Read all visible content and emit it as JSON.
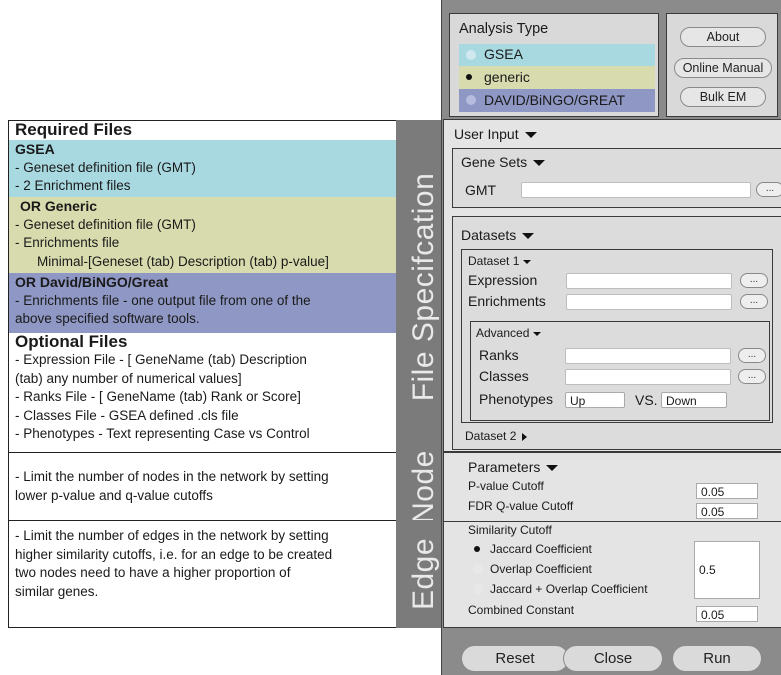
{
  "left": {
    "required_title": "Required Files",
    "gsea": {
      "title": "GSEA",
      "lines": [
        "- Geneset definition file (GMT)",
        "- 2 Enrichment files"
      ]
    },
    "generic": {
      "title": "OR Generic",
      "lines": [
        "- Geneset definition file (GMT)",
        "- Enrichments file",
        "Minimal-[Geneset (tab) Description (tab) p-value]"
      ]
    },
    "david": {
      "title": "OR David/BiNGO/Great",
      "lines": [
        "- Enrichments file - one output file from one of the",
        "above specified software tools."
      ]
    },
    "optional_title": "Optional Files",
    "optional_lines": [
      "- Expression File - [ GeneName (tab) Description",
      "(tab) any number of numerical values]",
      "- Ranks File -  [ GeneName (tab) Rank or Score]",
      "- Classes File - GSEA defined .cls file",
      "- Phenotypes - Text representing Case vs Control"
    ],
    "file_spec_label": "File Specifcation",
    "node_text": [
      "- Limit the number of nodes in the network by setting",
      "lower p-value and q-value cutoffs"
    ],
    "node_label": "Node",
    "edge_text": [
      "- Limit the number of edges in the network by setting",
      "higher similarity cutoffs, i.e. for an edge to be created",
      "two nodes need to have a higher proportion of",
      "similar genes."
    ],
    "edge_label": "Edge"
  },
  "app": {
    "analysis_type": {
      "title": "Analysis Type",
      "options": [
        "GSEA",
        "generic",
        "DAVID/BiNGO/GREAT"
      ],
      "selected": "generic"
    },
    "buttons": {
      "about": "About",
      "manual": "Online Manual",
      "bulk": "Bulk EM"
    },
    "user_input": "User Input",
    "gene_sets": {
      "title": "Gene Sets",
      "gmt_label": "GMT",
      "gmt_value": ""
    },
    "datasets": {
      "title": "Datasets",
      "dataset1": "Dataset 1",
      "expression": "Expression",
      "enrichments": "Enrichments",
      "advanced": "Advanced",
      "ranks": "Ranks",
      "classes": "Classes",
      "phenotypes": "Phenotypes",
      "up": "Up",
      "vs": "VS.",
      "down": "Down",
      "dataset2": "Dataset 2",
      "browse": "..."
    },
    "parameters": {
      "title": "Parameters",
      "pvalue_label": "P-value Cutoff",
      "pvalue": "0.05",
      "fdr_label": "FDR Q-value Cutoff",
      "fdr": "0.05",
      "similarity_label": "Similarity Cutoff",
      "similarity_options": [
        "Jaccard Coefficient",
        "Overlap Coefficient",
        "Jaccard + Overlap Coefficient"
      ],
      "similarity_selected": "Jaccard Coefficient",
      "similarity_value": "0.5",
      "combined_label": "Combined Constant",
      "combined_value": "0.05"
    },
    "actions": {
      "reset": "Reset",
      "close": "Close",
      "run": "Run"
    }
  },
  "colors": {
    "gsea": "#a8d8e0",
    "generic": "#d8dbad",
    "david": "#8f97c4",
    "label_gray": "#7b7b7b",
    "app_bg": "#8b8b8b"
  }
}
